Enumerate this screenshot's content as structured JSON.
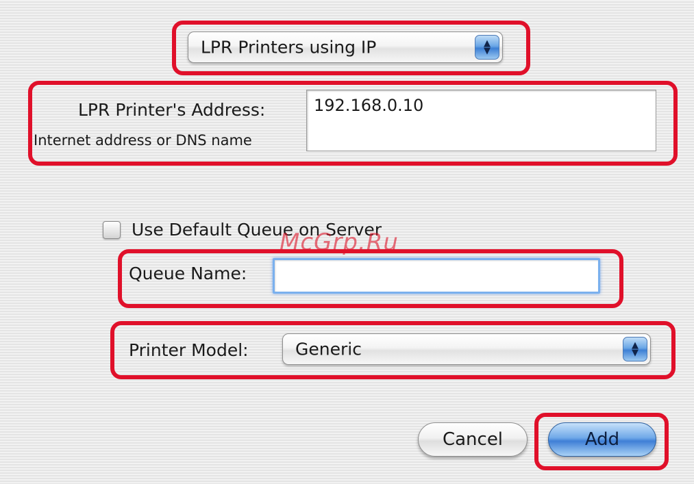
{
  "protocol_popup": {
    "selected": "LPR Printers using IP"
  },
  "address": {
    "label": "LPR Printer's Address:",
    "hint": "Internet address or DNS name",
    "value": "192.168.0.10"
  },
  "default_queue": {
    "label": "Use Default Queue on Server",
    "checked": false
  },
  "queue_name": {
    "label": "Queue Name:",
    "value": ""
  },
  "printer_model": {
    "label": "Printer Model:",
    "selected": "Generic"
  },
  "buttons": {
    "cancel": "Cancel",
    "add": "Add"
  },
  "watermark": "McGrp.Ru",
  "colors": {
    "highlight": "#e0102a",
    "aqua_blue": "#3f7fd6",
    "focus_ring": "#7ab0ee"
  }
}
